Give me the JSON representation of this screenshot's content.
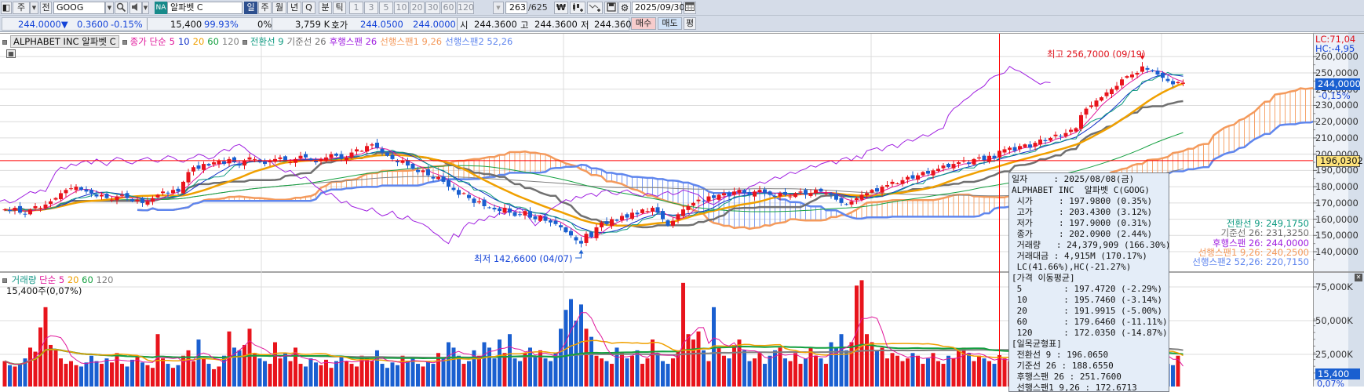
{
  "toolbar": {
    "period_type": "주",
    "all_label": "전",
    "symbol": "GOOG",
    "market_badge": "NA",
    "name": "알파벳 C",
    "periods": [
      "일",
      "주",
      "월",
      "년",
      "Q"
    ],
    "selected_period": "일",
    "intraday": [
      "분",
      "틱"
    ],
    "intervals": [
      "1",
      "3",
      "5",
      "10",
      "20",
      "30",
      "60",
      "120"
    ],
    "count_current": "263",
    "count_total": "/625",
    "date": "2025/09/30",
    "icons": [
      "layout-icon",
      "search-icon",
      "speaker-icon",
      "currency-icon",
      "candle-add-icon",
      "line-add-icon",
      "save-icon",
      "gear-icon",
      "calendar-icon"
    ]
  },
  "quote": {
    "price": "244.0000▼",
    "change": "0.3600",
    "change_pct": "-0.15%",
    "volume": "15,400",
    "volume_ratio": "99.93%",
    "zero_pct": "0%",
    "amount": "3,759 K",
    "hoga_label": "호가",
    "ask": "244.0500",
    "bid": "244.0000",
    "open_label": "시",
    "open": "244.3600",
    "high_label": "고",
    "high": "244.3600",
    "low_label": "저",
    "low": "244.3600",
    "buy_label": "매수",
    "sell_label": "매도",
    "avg_label": "평"
  },
  "legend": {
    "name": "ALPHABET INC  알파벳 C",
    "ma_label": "종가 단순",
    "ma": [
      {
        "label": "5",
        "color": "#e0179b"
      },
      {
        "label": "10",
        "color": "#1030c8"
      },
      {
        "label": "20",
        "color": "#f0a000"
      },
      {
        "label": "60",
        "color": "#14a040"
      },
      {
        "label": "120",
        "color": "#808080"
      }
    ],
    "ichimoku": [
      {
        "label": "전환선 9",
        "color": "#0d9a80"
      },
      {
        "label": "기준선 26",
        "color": "#707070"
      },
      {
        "label": "후행스팬 26",
        "color": "#a020e0"
      },
      {
        "label": "선행스팬1 9,26",
        "color": "#f49a5c"
      },
      {
        "label": "선행스팬2 52,26",
        "color": "#5f86ee"
      }
    ],
    "volume_label": "거래량",
    "volume_ma_label": "단순 5",
    "volume_ma": [
      {
        "label": "20",
        "color": "#f0a000"
      },
      {
        "label": "60",
        "color": "#14a040"
      },
      {
        "label": "120",
        "color": "#808080"
      }
    ],
    "volume_today": "15,400주(0,07%)"
  },
  "annotations": {
    "high_text": "최고 256,7000 (09/19)",
    "high_value": 256.7,
    "low_text": "최저 142,6600 (04/07)",
    "low_value": 142.66
  },
  "axis": {
    "lc": "LC:71,04",
    "hc": "HC:-4,95",
    "current_price": "244,0000",
    "current_change": "-0,15%",
    "ref_line": "196,0302",
    "ref_value": 196.0302,
    "price_ticks": [
      {
        "value": 260,
        "label": "260,0000"
      },
      {
        "value": 250,
        "label": "250,0000"
      },
      {
        "value": 240,
        "label": "240,0000"
      },
      {
        "value": 230,
        "label": "230,0000"
      },
      {
        "value": 220,
        "label": "220,0000"
      },
      {
        "value": 210,
        "label": "210,0000"
      },
      {
        "value": 200,
        "label": "200,0000"
      },
      {
        "value": 190,
        "label": "190,0000"
      },
      {
        "value": 180,
        "label": "180,0000"
      },
      {
        "value": 170,
        "label": "170,0000"
      },
      {
        "value": 160,
        "label": "160,0000"
      },
      {
        "value": 150,
        "label": "150,0000"
      },
      {
        "value": 140,
        "label": "140,0000"
      }
    ],
    "volume_ticks": [
      {
        "value": 75,
        "label": "75,000K"
      },
      {
        "value": 50,
        "label": "50,000K"
      },
      {
        "value": 25,
        "label": "25,000K"
      }
    ],
    "current_volume": "15,400",
    "current_volume_pct": "0,07%",
    "ichimoku_values": [
      {
        "text": "전환선 9: 249,1750",
        "color": "#0d9a80"
      },
      {
        "text": "기준선 26: 231,3250",
        "color": "#707070"
      },
      {
        "text": "후행스팬 26: 244,0000",
        "color": "#a020e0"
      },
      {
        "text": "선행스팬1 9,26: 240,2500",
        "color": "#f49a5c"
      },
      {
        "text": "선행스팬2 52,26: 220,7150",
        "color": "#5f86ee"
      }
    ]
  },
  "tooltip": [
    "일자     : 2025/08/08(금)",
    "ALPHABET INC  알파벳 C(GOOG)",
    " 시가     : 197.9800 (0.35%)",
    " 고가     : 203.4300 (3.12%)",
    " 저가     : 197.9000 (0.31%)",
    " 종가     : 202.0900 (2.44%)",
    " 거래량   : 24,379,909 (166.30%)",
    " 거래대금 : 4,915M (170.17%)",
    " LC(41.66%),HC(-21.27%)",
    "[가격 이동평균]",
    " 5        : 197.4720 (-2.29%)",
    " 10       : 195.7460 (-3.14%)",
    " 20       : 191.9915 (-5.00%)",
    " 60       : 179.6460 (-11.11%)",
    " 120      : 172.0350 (-14.87%)",
    "[일목균형표]",
    " 전환선 9 : 196.0650",
    " 기준선 26 : 188.6550",
    " 후행스팬 26 : 251.7600",
    " 선행스팬1 9,26 : 172.6713"
  ],
  "colors": {
    "up": "#e8141c",
    "down": "#1a5fd0",
    "crosshair": "#ff0000",
    "ref_line": "#ff0000",
    "accent": "#2d4f8e"
  },
  "chart_data": {
    "type": "candlestick",
    "last_date": "2025/09/30",
    "crosshair_date": "2025/08/08",
    "crosshair_ohlc": {
      "open": 197.98,
      "high": 203.43,
      "low": 197.9,
      "close": 202.09
    },
    "ylim": [
      135,
      262
    ],
    "close": [
      166,
      165,
      167,
      164,
      163,
      166,
      168,
      167,
      169,
      171,
      173,
      176,
      178,
      179,
      180,
      178,
      177,
      176,
      174,
      175,
      173,
      172,
      174,
      175,
      173,
      171,
      172,
      170,
      171,
      173,
      175,
      177,
      176,
      178,
      177,
      183,
      189,
      192,
      191,
      194,
      193,
      195,
      196,
      194,
      197,
      195,
      193,
      196,
      198,
      197,
      195,
      194,
      196,
      197,
      198,
      196,
      195,
      197,
      199,
      198,
      196,
      195,
      197,
      198,
      200,
      199,
      197,
      198,
      201,
      203,
      202,
      205,
      206,
      204,
      201,
      199,
      197,
      195,
      196,
      193,
      191,
      189,
      190,
      187,
      185,
      186,
      183,
      180,
      178,
      175,
      176,
      173,
      170,
      171,
      168,
      167,
      166,
      165,
      167,
      164,
      162,
      163,
      165,
      161,
      160,
      162,
      159,
      158,
      157,
      155,
      152,
      150,
      147,
      145,
      151,
      149,
      155,
      158,
      157,
      160,
      159,
      162,
      161,
      164,
      163,
      166,
      165,
      167,
      164,
      160,
      156,
      159,
      163,
      166,
      168,
      170,
      172,
      171,
      174,
      173,
      175,
      176,
      174,
      177,
      178,
      176,
      175,
      177,
      178,
      176,
      175,
      174,
      176,
      175,
      174,
      176,
      177,
      175,
      176,
      178,
      177,
      176,
      175,
      172,
      170,
      169,
      171,
      173,
      175,
      176,
      178,
      177,
      180,
      181,
      183,
      182,
      184,
      186,
      185,
      187,
      189,
      188,
      190,
      191,
      193,
      192,
      194,
      195,
      196,
      194,
      197,
      198,
      196,
      199,
      197.3,
      202.09,
      203,
      204,
      202,
      205,
      206,
      204,
      207,
      209,
      208,
      210,
      212,
      211,
      213,
      215,
      216,
      224,
      228,
      230,
      233,
      235,
      238,
      240,
      242,
      246,
      248,
      249,
      250,
      254,
      252,
      251,
      249,
      247,
      245,
      243,
      244.36,
      244
    ],
    "volume_millions": [
      20,
      17,
      16,
      18,
      22,
      30,
      27,
      45,
      60,
      32,
      28,
      22,
      18,
      20,
      17,
      16,
      19,
      24,
      20,
      18,
      22,
      19,
      26,
      18,
      16,
      21,
      23,
      19,
      17,
      15,
      40,
      22,
      18,
      15,
      17,
      24,
      28,
      20,
      36,
      22,
      18,
      14,
      16,
      24,
      42,
      30,
      28,
      32,
      44,
      26,
      22,
      20,
      18,
      34,
      22,
      26,
      20,
      30,
      18,
      16,
      22,
      19,
      17,
      21,
      15,
      20,
      24,
      20,
      18,
      16,
      24,
      22,
      20,
      28,
      18,
      15,
      19,
      17,
      24,
      20,
      22,
      18,
      16,
      20,
      18,
      26,
      22,
      34,
      30,
      24,
      18,
      20,
      28,
      24,
      34,
      30,
      22,
      36,
      26,
      40,
      22,
      20,
      26,
      30,
      24,
      28,
      22,
      20,
      26,
      44,
      58,
      66,
      50,
      62,
      44,
      38,
      24,
      22,
      20,
      18,
      30,
      26,
      22,
      24,
      28,
      18,
      22,
      36,
      26,
      20,
      18,
      22,
      28,
      78,
      40,
      36,
      42,
      28,
      20,
      60,
      30,
      24,
      22,
      32,
      36,
      28,
      20,
      22,
      26,
      18,
      24,
      28,
      30,
      22,
      20,
      26,
      18,
      22,
      30,
      24,
      22,
      18,
      34,
      30,
      40,
      28,
      34,
      76,
      80,
      40,
      34,
      28,
      30,
      22,
      26,
      24,
      20,
      22,
      26,
      24,
      18,
      22,
      26,
      20,
      18,
      24,
      22,
      28,
      30,
      26,
      20,
      24,
      22,
      20,
      18,
      24.4,
      22,
      20,
      26,
      18,
      22,
      26,
      32,
      38,
      50,
      36,
      30,
      22,
      20,
      24,
      46,
      38,
      30,
      28,
      26,
      34,
      30,
      24,
      22,
      28,
      32,
      26,
      22,
      20,
      30,
      24,
      26,
      22,
      18,
      17,
      24,
      0.0154
    ]
  }
}
